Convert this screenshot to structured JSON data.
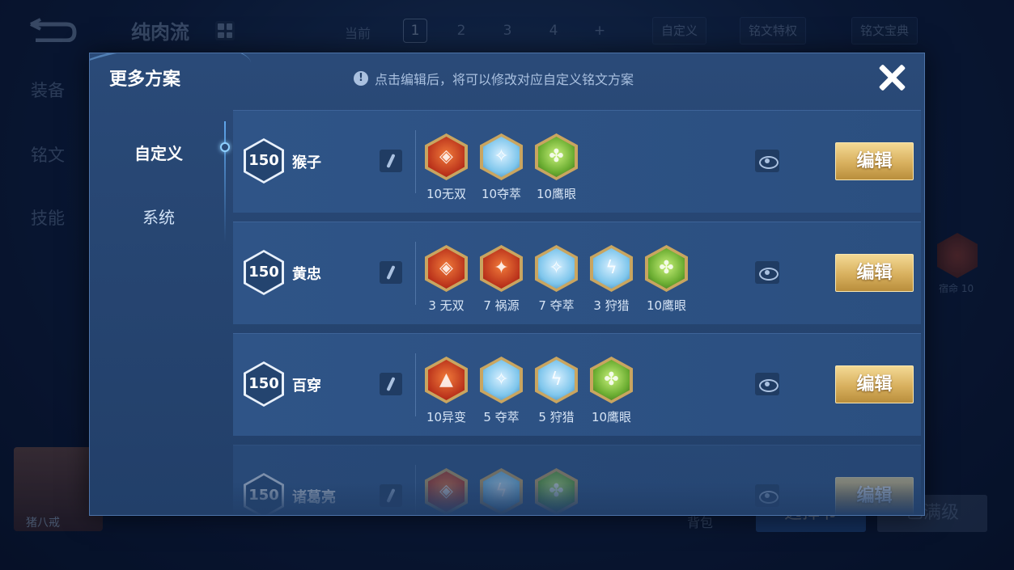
{
  "background": {
    "scheme_name": "纯肉流",
    "current_label": "当前",
    "page_tabs": [
      "1",
      "2",
      "3",
      "4",
      "+"
    ],
    "custom_btn": "自定义",
    "privilege_btn": "铭文特权",
    "collection_btn": "铭文宝典",
    "side_nav": [
      "装备",
      "铭文",
      "技能"
    ],
    "hero_name": "猪八戒",
    "bag_label": "背包",
    "select_btn": "选择节",
    "maxed_btn": "已满级",
    "right_rune_label": "宿命 10"
  },
  "modal": {
    "title": "更多方案",
    "hint_icon": "!",
    "hint": "点击编辑后，将可以修改对应自定义铭文方案",
    "close_icon": "close-icon"
  },
  "left_nav": {
    "items": [
      {
        "label": "自定义",
        "active": true
      },
      {
        "label": "系统",
        "active": false
      }
    ]
  },
  "schemes": [
    {
      "level": "150",
      "name": "猴子",
      "edit_label": "编辑",
      "runes": [
        {
          "label": "10无双",
          "color": "red",
          "symbol": "◈"
        },
        {
          "label": "10夺萃",
          "color": "blue",
          "symbol": "✧"
        },
        {
          "label": "10鹰眼",
          "color": "green",
          "symbol": "✤"
        }
      ]
    },
    {
      "level": "150",
      "name": "黄忠",
      "edit_label": "编辑",
      "runes": [
        {
          "label": "3 无双",
          "color": "red",
          "symbol": "◈"
        },
        {
          "label": "7 祸源",
          "color": "red",
          "symbol": "✦"
        },
        {
          "label": "7 夺萃",
          "color": "blue",
          "symbol": "✧"
        },
        {
          "label": "3 狩猎",
          "color": "blue",
          "symbol": "ϟ"
        },
        {
          "label": "10鹰眼",
          "color": "green",
          "symbol": "✤"
        }
      ]
    },
    {
      "level": "150",
      "name": "百穿",
      "edit_label": "编辑",
      "runes": [
        {
          "label": "10异变",
          "color": "red",
          "symbol": "▲"
        },
        {
          "label": "5 夺萃",
          "color": "blue",
          "symbol": "✧"
        },
        {
          "label": "5 狩猎",
          "color": "blue",
          "symbol": "ϟ"
        },
        {
          "label": "10鹰眼",
          "color": "green",
          "symbol": "✤"
        }
      ]
    },
    {
      "level": "150",
      "name": "诸葛亮",
      "edit_label": "编辑",
      "runes": [
        {
          "label": "",
          "color": "red",
          "symbol": "◈"
        },
        {
          "label": "",
          "color": "blue",
          "symbol": "ϟ"
        },
        {
          "label": "",
          "color": "green",
          "symbol": "✤"
        }
      ]
    }
  ]
}
